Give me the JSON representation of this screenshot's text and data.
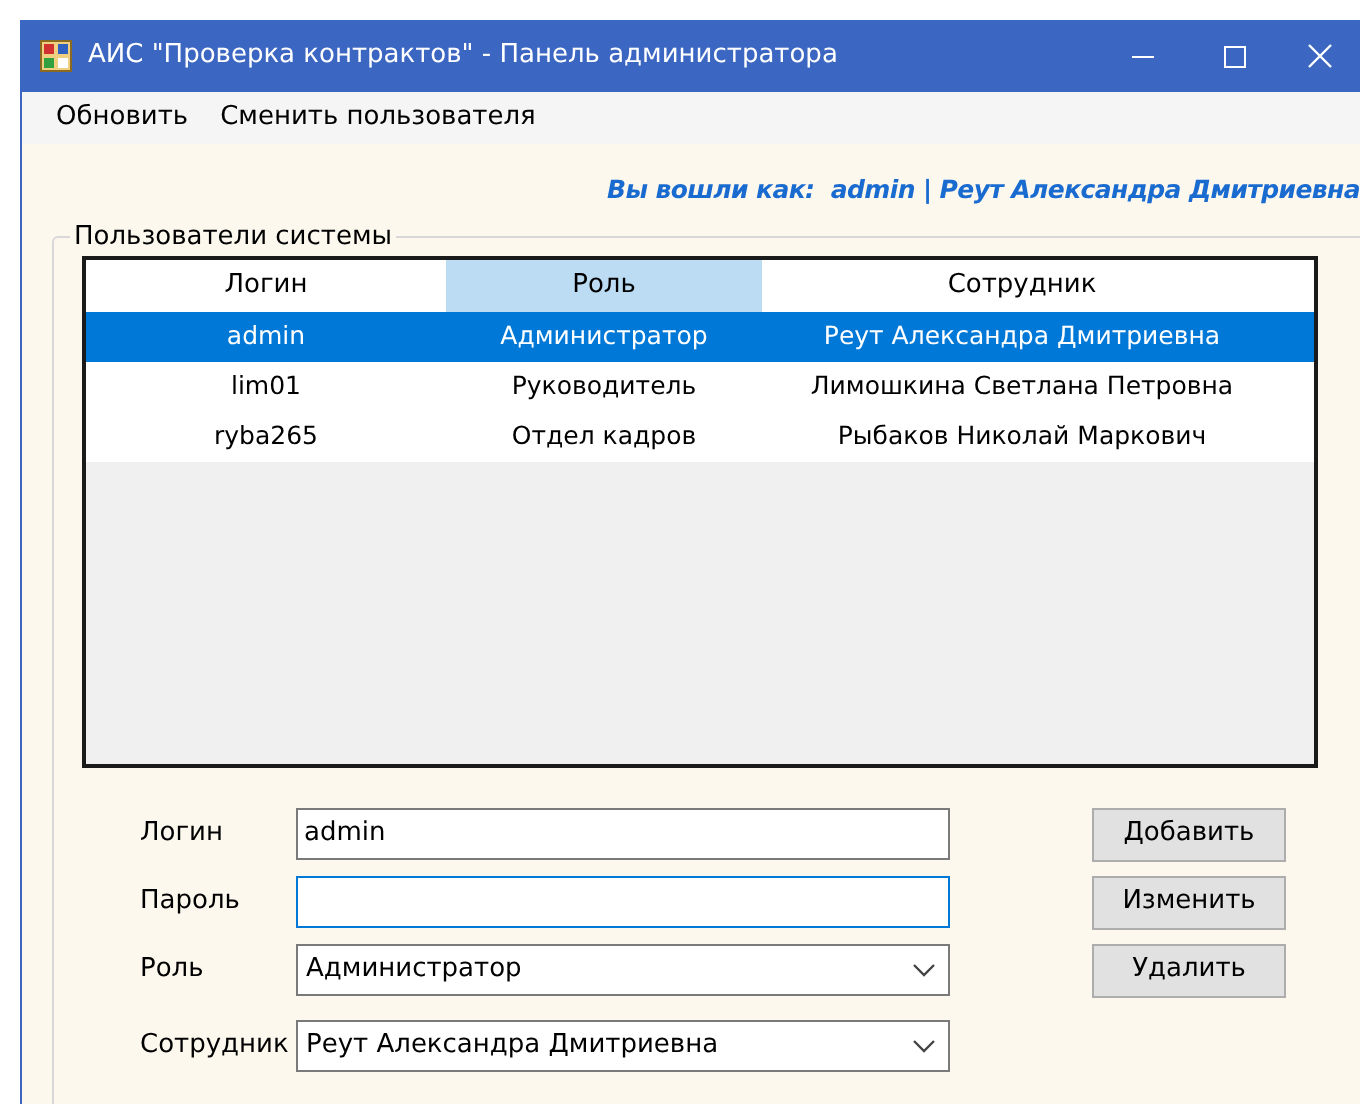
{
  "window": {
    "title": "АИС \"Проверка контрактов\" - Панель администратора"
  },
  "menu": [
    {
      "label": "Обновить"
    },
    {
      "label": "Сменить пользователя"
    }
  ],
  "session": "Вы вошли как:  admin | Реут Александра Дмитриевна",
  "users_group": {
    "title": "Пользователи системы",
    "columns": [
      {
        "label": "Логин",
        "selected": false
      },
      {
        "label": "Роль",
        "selected": true
      },
      {
        "label": "Сотрудник",
        "selected": false
      }
    ],
    "rows": [
      {
        "cells": [
          "admin",
          "Администратор",
          "Реут Александра Дмитриевна"
        ],
        "selected": true
      },
      {
        "cells": [
          "lim01",
          "Руководитель",
          "Лимошкина Светлана Петровна"
        ],
        "selected": false
      },
      {
        "cells": [
          "ryba265",
          "Отдел кадров",
          "Рыбаков Николай Маркович"
        ],
        "selected": false
      }
    ]
  },
  "form": {
    "fields": [
      {
        "label": "Логин",
        "kind": "text",
        "value": "admin",
        "focused": false
      },
      {
        "label": "Пароль",
        "kind": "text",
        "focused": true
      },
      {
        "label": "Роль",
        "kind": "dropdown",
        "value": "Администратор",
        "focused": false
      },
      {
        "label": "Сотрудник",
        "kind": "dropdown",
        "value": "Реут Александра Дмитриевна",
        "focused": false
      }
    ],
    "buttons": [
      "Добавить",
      "Изменить",
      "Удалить"
    ]
  }
}
